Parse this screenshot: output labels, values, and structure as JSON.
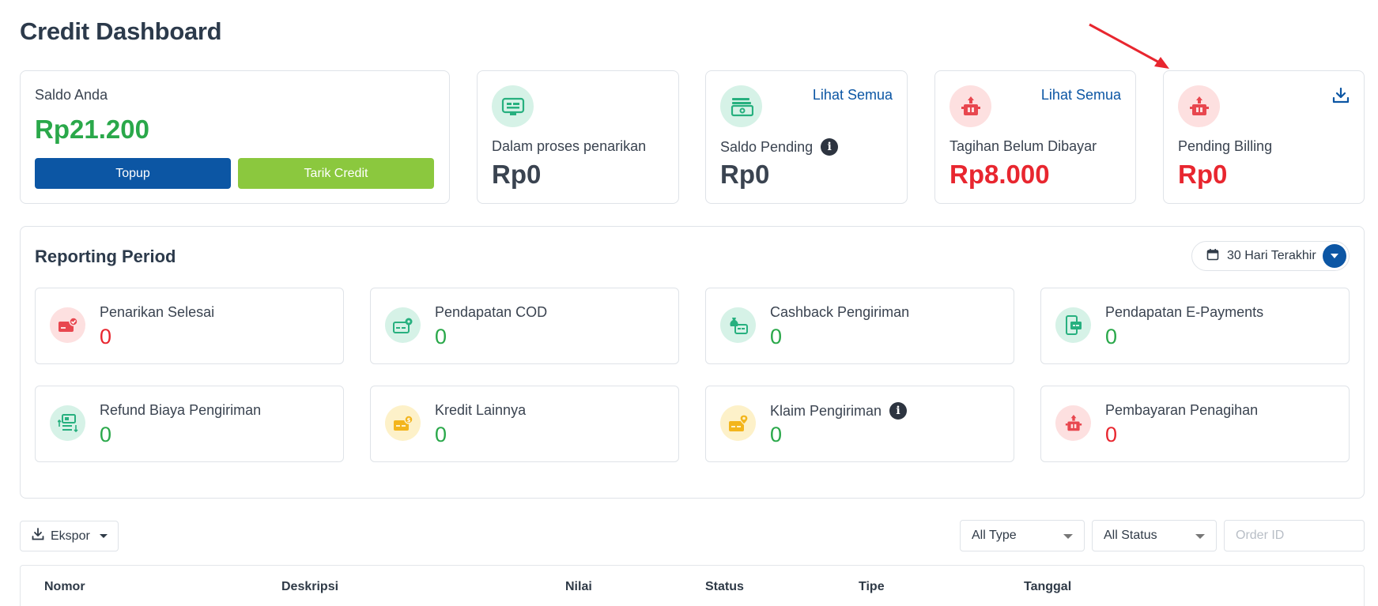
{
  "page": {
    "title": "Credit Dashboard"
  },
  "balance": {
    "label": "Saldo Anda",
    "value": "Rp21.200",
    "topup_label": "Topup",
    "withdraw_label": "Tarik Credit"
  },
  "summary": {
    "withdraw_process": {
      "label": "Dalam proses penarikan",
      "value": "Rp0",
      "icon": "cash-register-icon"
    },
    "pending_balance": {
      "label": "Saldo Pending",
      "value": "Rp0",
      "link": "Lihat Semua",
      "icon": "cash-stack-icon"
    },
    "unpaid_bills": {
      "label": "Tagihan Belum Dibayar",
      "value": "Rp8.000",
      "link": "Lihat Semua",
      "icon": "bill-machine-icon"
    },
    "pending_billing": {
      "label": "Pending Billing",
      "value": "Rp0",
      "icon": "bill-machine-icon"
    }
  },
  "reporting": {
    "title": "Reporting Period",
    "period": "30 Hari Terakhir",
    "items": [
      {
        "label": "Penarikan Selesai",
        "value": "0",
        "icon": "card-check-icon",
        "tone": "red"
      },
      {
        "label": "Pendapatan COD",
        "value": "0",
        "icon": "card-gear-icon",
        "tone": "green"
      },
      {
        "label": "Cashback Pengiriman",
        "value": "0",
        "icon": "money-bag-icon",
        "tone": "green"
      },
      {
        "label": "Pendapatan E-Payments",
        "value": "0",
        "icon": "mobile-payment-icon",
        "tone": "green"
      },
      {
        "label": "Refund Biaya Pengiriman",
        "value": "0",
        "icon": "refund-icon",
        "tone": "green"
      },
      {
        "label": "Kredit Lainnya",
        "value": "0",
        "icon": "card-coin-icon",
        "tone": "yellow"
      },
      {
        "label": "Klaim Pengiriman",
        "value": "0",
        "icon": "card-pin-icon",
        "tone": "yellow"
      },
      {
        "label": "Pembayaran Penagihan",
        "value": "0",
        "icon": "bill-machine-icon",
        "tone": "red"
      }
    ]
  },
  "toolbar": {
    "export_label": "Ekspor",
    "type_filter": "All Type",
    "status_filter": "All Status",
    "order_placeholder": "Order ID"
  },
  "table": {
    "columns": [
      "Nomor",
      "Deskripsi",
      "Nilai",
      "Status",
      "Tipe",
      "Tanggal"
    ]
  },
  "colors": {
    "primary": "#0c56a4",
    "success": "#2aa84a",
    "danger": "#e8262f",
    "lime": "#8bc83e"
  }
}
